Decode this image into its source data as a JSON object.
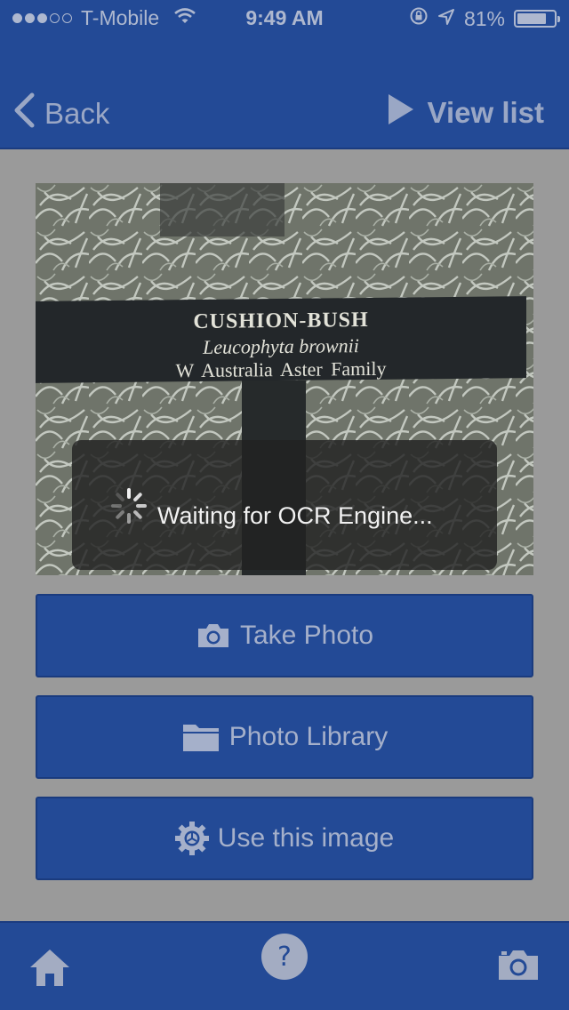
{
  "status_bar": {
    "carrier": "T-Mobile",
    "time": "9:49 AM",
    "battery": "81%",
    "battery_level": 0.81,
    "signal_bars_filled": 3,
    "signal_bars_total": 5
  },
  "nav": {
    "back_label": "Back",
    "view_list_label": "View list"
  },
  "photo": {
    "sign_line1": "CUSHION-BUSH",
    "sign_line2": "Leucophyta brownii",
    "sign_line3": "W Australia   Aster Family"
  },
  "hud": {
    "message": "Waiting for OCR Engine..."
  },
  "actions": {
    "take_photo_label": "Take Photo",
    "photo_library_label": "Photo Library",
    "use_image_label": "Use this image"
  },
  "tab_bar": {
    "help_glyph": "?"
  },
  "icons": {
    "wifi": "wifi-icon",
    "lock_rotation": "orientation-lock-icon",
    "location": "location-arrow-icon",
    "battery": "battery-icon",
    "back": "chevron-left-icon",
    "view_list": "play-triangle-icon",
    "camera": "camera-icon",
    "folder": "folder-icon",
    "gear": "gear-icon",
    "home": "home-icon",
    "help": "help-icon"
  },
  "colors": {
    "bar": "#234a96",
    "overlay_gray": "#9a9a9a",
    "hud": "#222222"
  }
}
